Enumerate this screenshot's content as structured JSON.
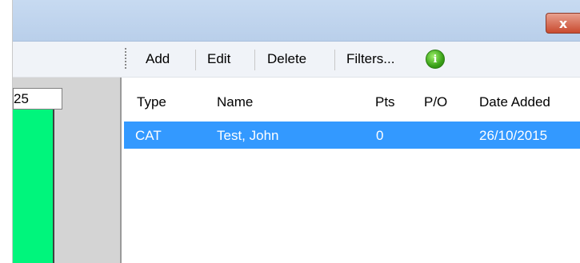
{
  "window": {
    "close_label": "x"
  },
  "toolbar": {
    "add_label": "Add",
    "edit_label": "Edit",
    "delete_label": "Delete",
    "filters_label": "Filters...",
    "info_icon": "i"
  },
  "grid": {
    "cell_value": "25",
    "cell_color": "#00f57c"
  },
  "list": {
    "columns": [
      "Type",
      "Name",
      "Pts",
      "P/O",
      "Date Added"
    ],
    "rows": [
      {
        "type": "CAT",
        "name": "Test, John",
        "pts": "0",
        "po": "",
        "date_added": "26/10/2015",
        "selected": true
      }
    ],
    "selection_color": "#3399ff"
  }
}
